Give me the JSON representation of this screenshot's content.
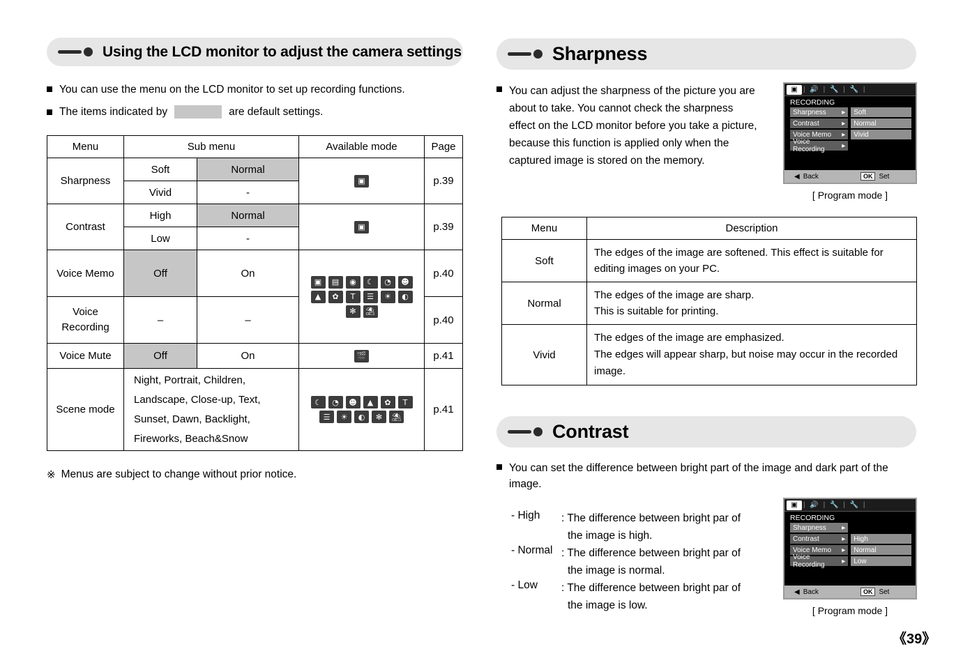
{
  "left": {
    "header": "Using the LCD monitor to adjust the camera settings",
    "bullets": [
      "You can use the menu on the LCD monitor to set up recording functions.",
      "The items indicated by",
      "are default settings."
    ],
    "table": {
      "headers": [
        "Menu",
        "Sub menu",
        "Available mode",
        "Page"
      ],
      "rows": [
        {
          "menu": "Sharpness",
          "sub": [
            [
              "Soft",
              "Normal"
            ],
            [
              "Vivid",
              "-"
            ]
          ],
          "shaded": [
            "",
            "Normal"
          ],
          "modes": [
            "camera-auto"
          ],
          "page": "p.39"
        },
        {
          "menu": "Contrast",
          "sub": [
            [
              "High",
              "Normal"
            ],
            [
              "Low",
              "-"
            ]
          ],
          "shaded": [
            "",
            "Normal"
          ],
          "modes": [
            "camera-auto"
          ],
          "page": "p.39"
        },
        {
          "menu": "Voice Memo",
          "sub": [
            [
              "Off",
              "On"
            ]
          ],
          "shaded": [
            "Off",
            ""
          ],
          "modes": [
            "auto",
            "program",
            "asr",
            "night",
            "mysetting",
            "portrait",
            "landscape",
            "close-up",
            "text",
            "sunset",
            "dawn",
            "backlight",
            "fireworks",
            "beach"
          ],
          "page": "p.40"
        },
        {
          "menu": "Voice Recording",
          "sub": [
            [
              "–",
              "–"
            ]
          ],
          "shaded": [
            "",
            ""
          ],
          "modes": [],
          "page": "p.40"
        },
        {
          "menu": "Voice Mute",
          "sub": [
            [
              "Off",
              "On"
            ]
          ],
          "shaded": [
            "Off",
            ""
          ],
          "modes": [
            "movie"
          ],
          "page": "p.41"
        },
        {
          "menu": "Scene mode",
          "sub": [
            [
              "Night, Portrait, Children, Landscape, Close-up, Text, Sunset, Dawn, Backlight, Fireworks, Beach&Snow",
              ""
            ]
          ],
          "shaded": [
            "",
            ""
          ],
          "modes": [
            "night",
            "mysetting",
            "portrait",
            "landscape",
            "close-up",
            "text",
            "sunset",
            "dawn",
            "backlight",
            "fireworks",
            "beach"
          ],
          "page": "p.41"
        }
      ]
    },
    "note": "Menus are subject to change without prior notice.",
    "note_mark": "※"
  },
  "sharpness": {
    "header": "Sharpness",
    "bullet": "You can adjust the sharpness of the picture you are about to take. You cannot check the sharpness effect on the LCD monitor before you take a picture, because this function is applied only when the captured image is stored on the memory.",
    "caption": "[ Program mode ]",
    "lcd": {
      "title": "RECORDING",
      "tabs": [
        "camera-icon",
        "speaker-icon",
        "wrench1-icon",
        "wrench2-icon"
      ],
      "items": [
        {
          "label": "Sharpness",
          "value": "Soft"
        },
        {
          "label": "Contrast",
          "value": "Normal"
        },
        {
          "label": "Voice Memo",
          "value": "Vivid"
        },
        {
          "label": "Voice Recording",
          "value": ""
        }
      ],
      "back": "Back",
      "ok": "OK",
      "set": "Set"
    },
    "table": {
      "headers": [
        "Menu",
        "Description"
      ],
      "rows": [
        {
          "menu": "Soft",
          "desc": "The edges of the image are softened. This effect is suitable for editing images on your PC."
        },
        {
          "menu": "Normal",
          "desc": "The edges of the image are sharp.\nThis is suitable for printing."
        },
        {
          "menu": "Vivid",
          "desc": "The edges of the image are emphasized.\nThe edges will appear sharp, but noise may occur in the recorded image."
        }
      ]
    }
  },
  "contrast": {
    "header": "Contrast",
    "bullet": "You can set the difference between bright part of the image and dark part of the image.",
    "lines": [
      {
        "label": "- High",
        "colon": ": The difference between bright par of",
        "cont": "the image is high."
      },
      {
        "label": "- Normal",
        "colon": ": The difference between bright par of",
        "cont": "the image is normal."
      },
      {
        "label": "- Low",
        "colon": ": The difference between bright par of",
        "cont": "the image is low."
      }
    ],
    "caption": "[ Program mode ]",
    "lcd": {
      "title": "RECORDING",
      "items": [
        {
          "label": "Sharpness",
          "value": ""
        },
        {
          "label": "Contrast",
          "value": "High"
        },
        {
          "label": "Voice Memo",
          "value": "Normal"
        },
        {
          "label": "Voice Recording",
          "value": "Low"
        }
      ],
      "back": "Back",
      "ok": "OK",
      "set": "Set"
    }
  },
  "page_number": "《39》"
}
